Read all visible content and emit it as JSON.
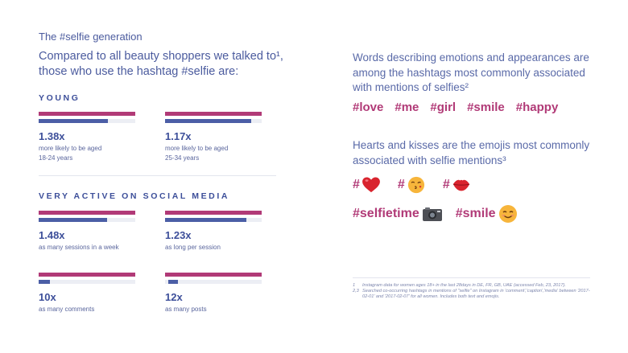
{
  "eyebrow": "The #selfie generation",
  "intro": "Compared to all beauty shoppers we talked to¹, those who use the hashtag #selfie are:",
  "young": {
    "title": "YOUNG",
    "stats": [
      {
        "value": "1.38x",
        "line1": "more likely to be aged",
        "line2": "18-24 years",
        "fill": 0.72
      },
      {
        "value": "1.17x",
        "line1": "more likely to be aged",
        "line2": "25-34 years",
        "fill": 0.89
      }
    ]
  },
  "social": {
    "title": "VERY ACTIVE ON SOCIAL MEDIA",
    "stats": [
      {
        "value": "1.48x",
        "line1": "as many sessions in a week",
        "fill": 0.71
      },
      {
        "value": "1.23x",
        "line1": "as long per session",
        "fill": 0.84
      },
      {
        "value": "10x",
        "line1": "as many comments",
        "fill": 0.12
      },
      {
        "value": "12x",
        "line1": "as many posts",
        "fill": 0.1
      }
    ]
  },
  "words": {
    "heading": "Words describing emotions and appearances are among the hashtags most commonly associated with mentions of selfies²",
    "tags": [
      "#love",
      "#me",
      "#girl",
      "#smile",
      "#happy"
    ]
  },
  "emojis": {
    "heading": "Hearts and kisses are the emojis most commonly associated with selfie mentions³",
    "row1": [
      {
        "hash": "#",
        "emoji": "heart-emoji"
      },
      {
        "hash": "#",
        "emoji": "kiss-face-emoji"
      },
      {
        "hash": "#",
        "emoji": "lips-emoji"
      }
    ],
    "row2": [
      {
        "text": "#selfietime",
        "emoji": "camera-emoji"
      },
      {
        "text": "#smile",
        "emoji": "smiling-face-emoji"
      }
    ]
  },
  "footnotes": [
    {
      "num": "1",
      "text": "Instagram data for women ages 18+ in the last 28days in DE, FR, GB, UAE (accessed Feb, 23, 2017)."
    },
    {
      "num": "2,3",
      "text": "Searched co-occurring hashtags in mentions of \"selfie\" on Instagram in 'comment','caption','media' between '2017-02-01' and '2017-02-07' for all women. Includes both text and emojis."
    }
  ],
  "colors": {
    "magenta": "#b13a77",
    "blue": "#4b5ea6",
    "text": "#4b5b9e"
  }
}
